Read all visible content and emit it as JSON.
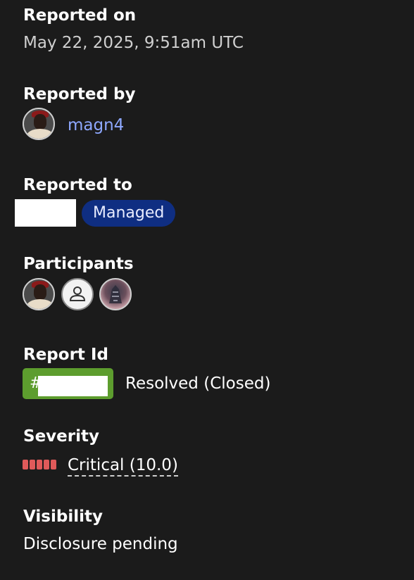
{
  "reported_on": {
    "label": "Reported on",
    "value": "May 22, 2025, 9:51am UTC"
  },
  "reported_by": {
    "label": "Reported by",
    "username": "magn4",
    "avatar_icon": "user-avatar"
  },
  "reported_to": {
    "label": "Reported to",
    "badge": "Managed",
    "badge_color": "#0f2e82"
  },
  "participants": {
    "label": "Participants",
    "avatars": [
      "user-avatar",
      "default-user-icon",
      "artwork-avatar"
    ]
  },
  "report_id": {
    "label": "Report Id",
    "prefix": "#",
    "status": "Resolved (Closed)",
    "badge_color": "#5d9d2e"
  },
  "severity": {
    "label": "Severity",
    "value": "Critical (10.0)",
    "color": "#e05a5a",
    "level": 5,
    "max_level": 5
  },
  "visibility": {
    "label": "Visibility",
    "value": "Disclosure pending"
  }
}
